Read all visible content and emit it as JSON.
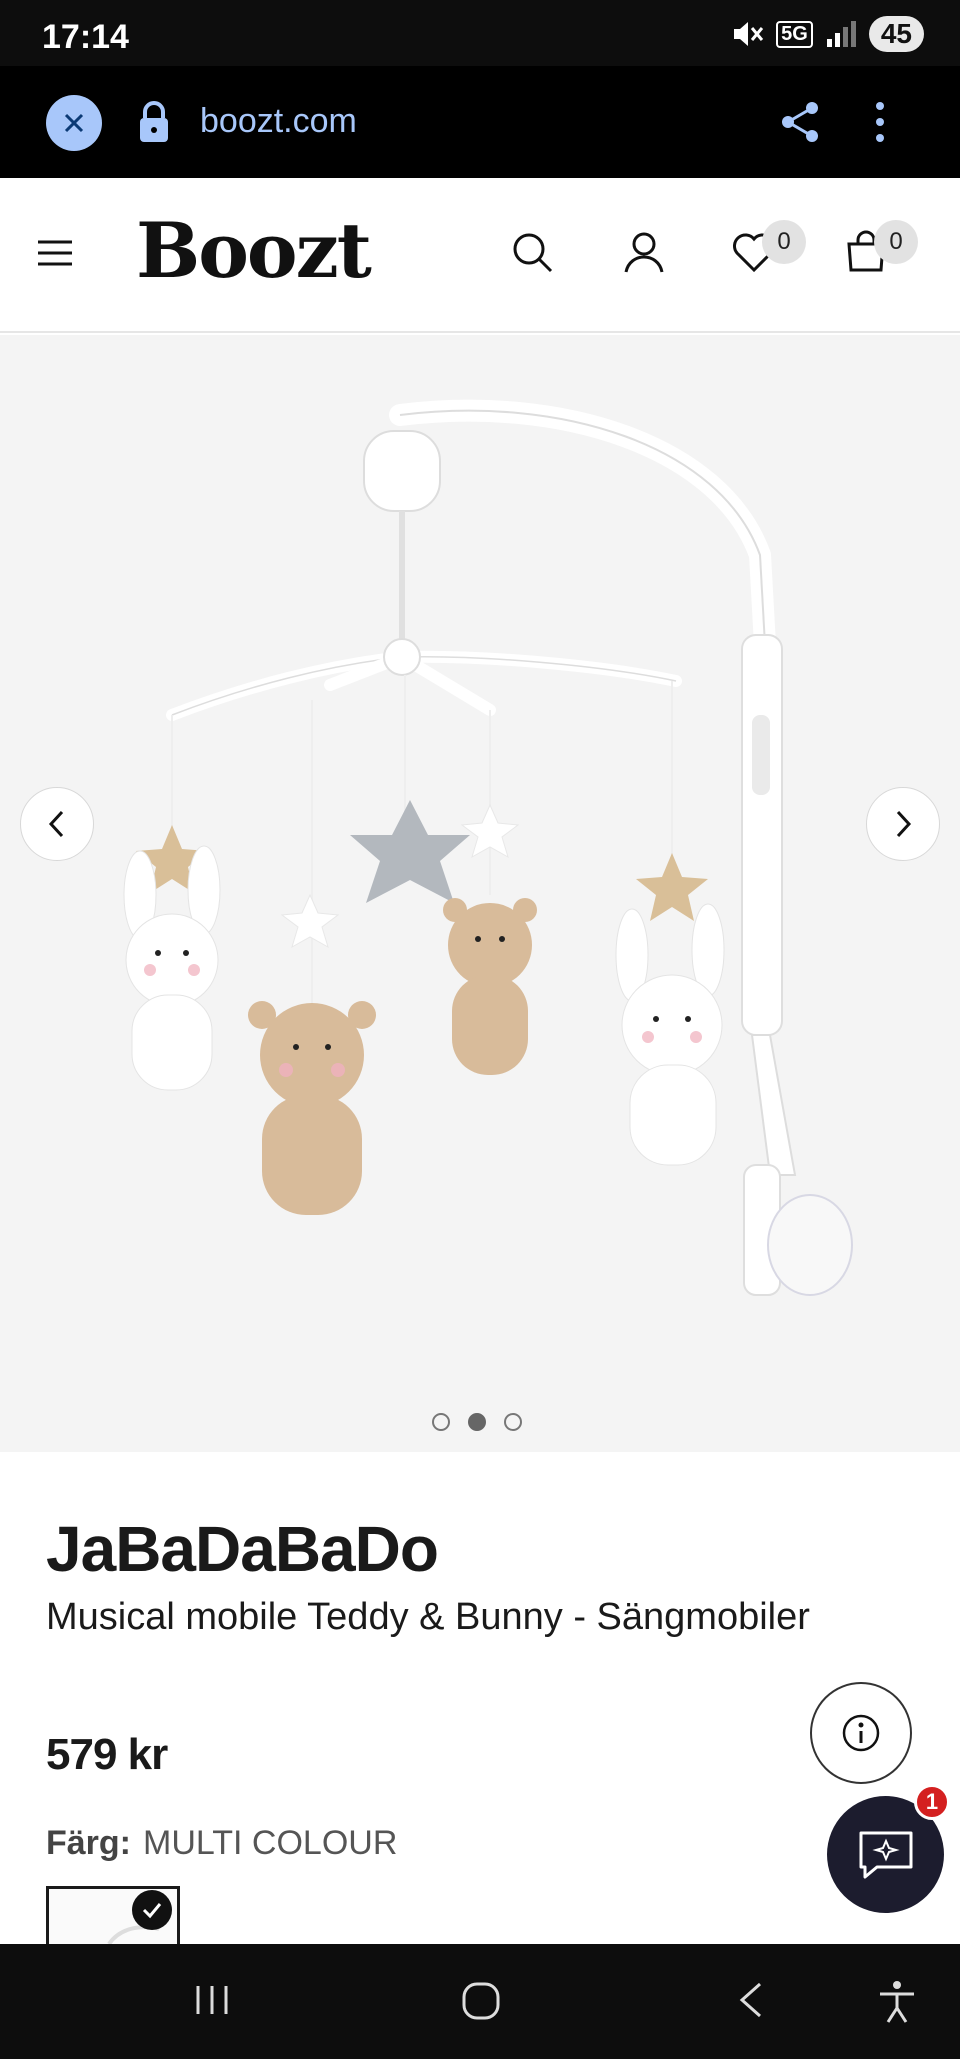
{
  "status_bar": {
    "time": "17:14",
    "network": "5G",
    "battery": "45"
  },
  "browser": {
    "url": "boozt.com"
  },
  "header": {
    "logo": "Boozt",
    "wishlist_count": "0",
    "cart_count": "0"
  },
  "gallery": {
    "image_alt": "Musical mobile with teddy bears, bunnies and stars",
    "slide_count": 3,
    "active_slide": 2
  },
  "product": {
    "brand": "JaBaDaBaDo",
    "name": "Musical mobile Teddy & Bunny - Sängmobiler",
    "price": "579 kr",
    "color_label": "Färg:",
    "color_value": "MULTI COLOUR"
  },
  "chat": {
    "unread": "1"
  },
  "colors": {
    "accent_blue": "#a8c7fa",
    "badge_red": "#d42020",
    "chat_bg": "#1c1c2e"
  }
}
